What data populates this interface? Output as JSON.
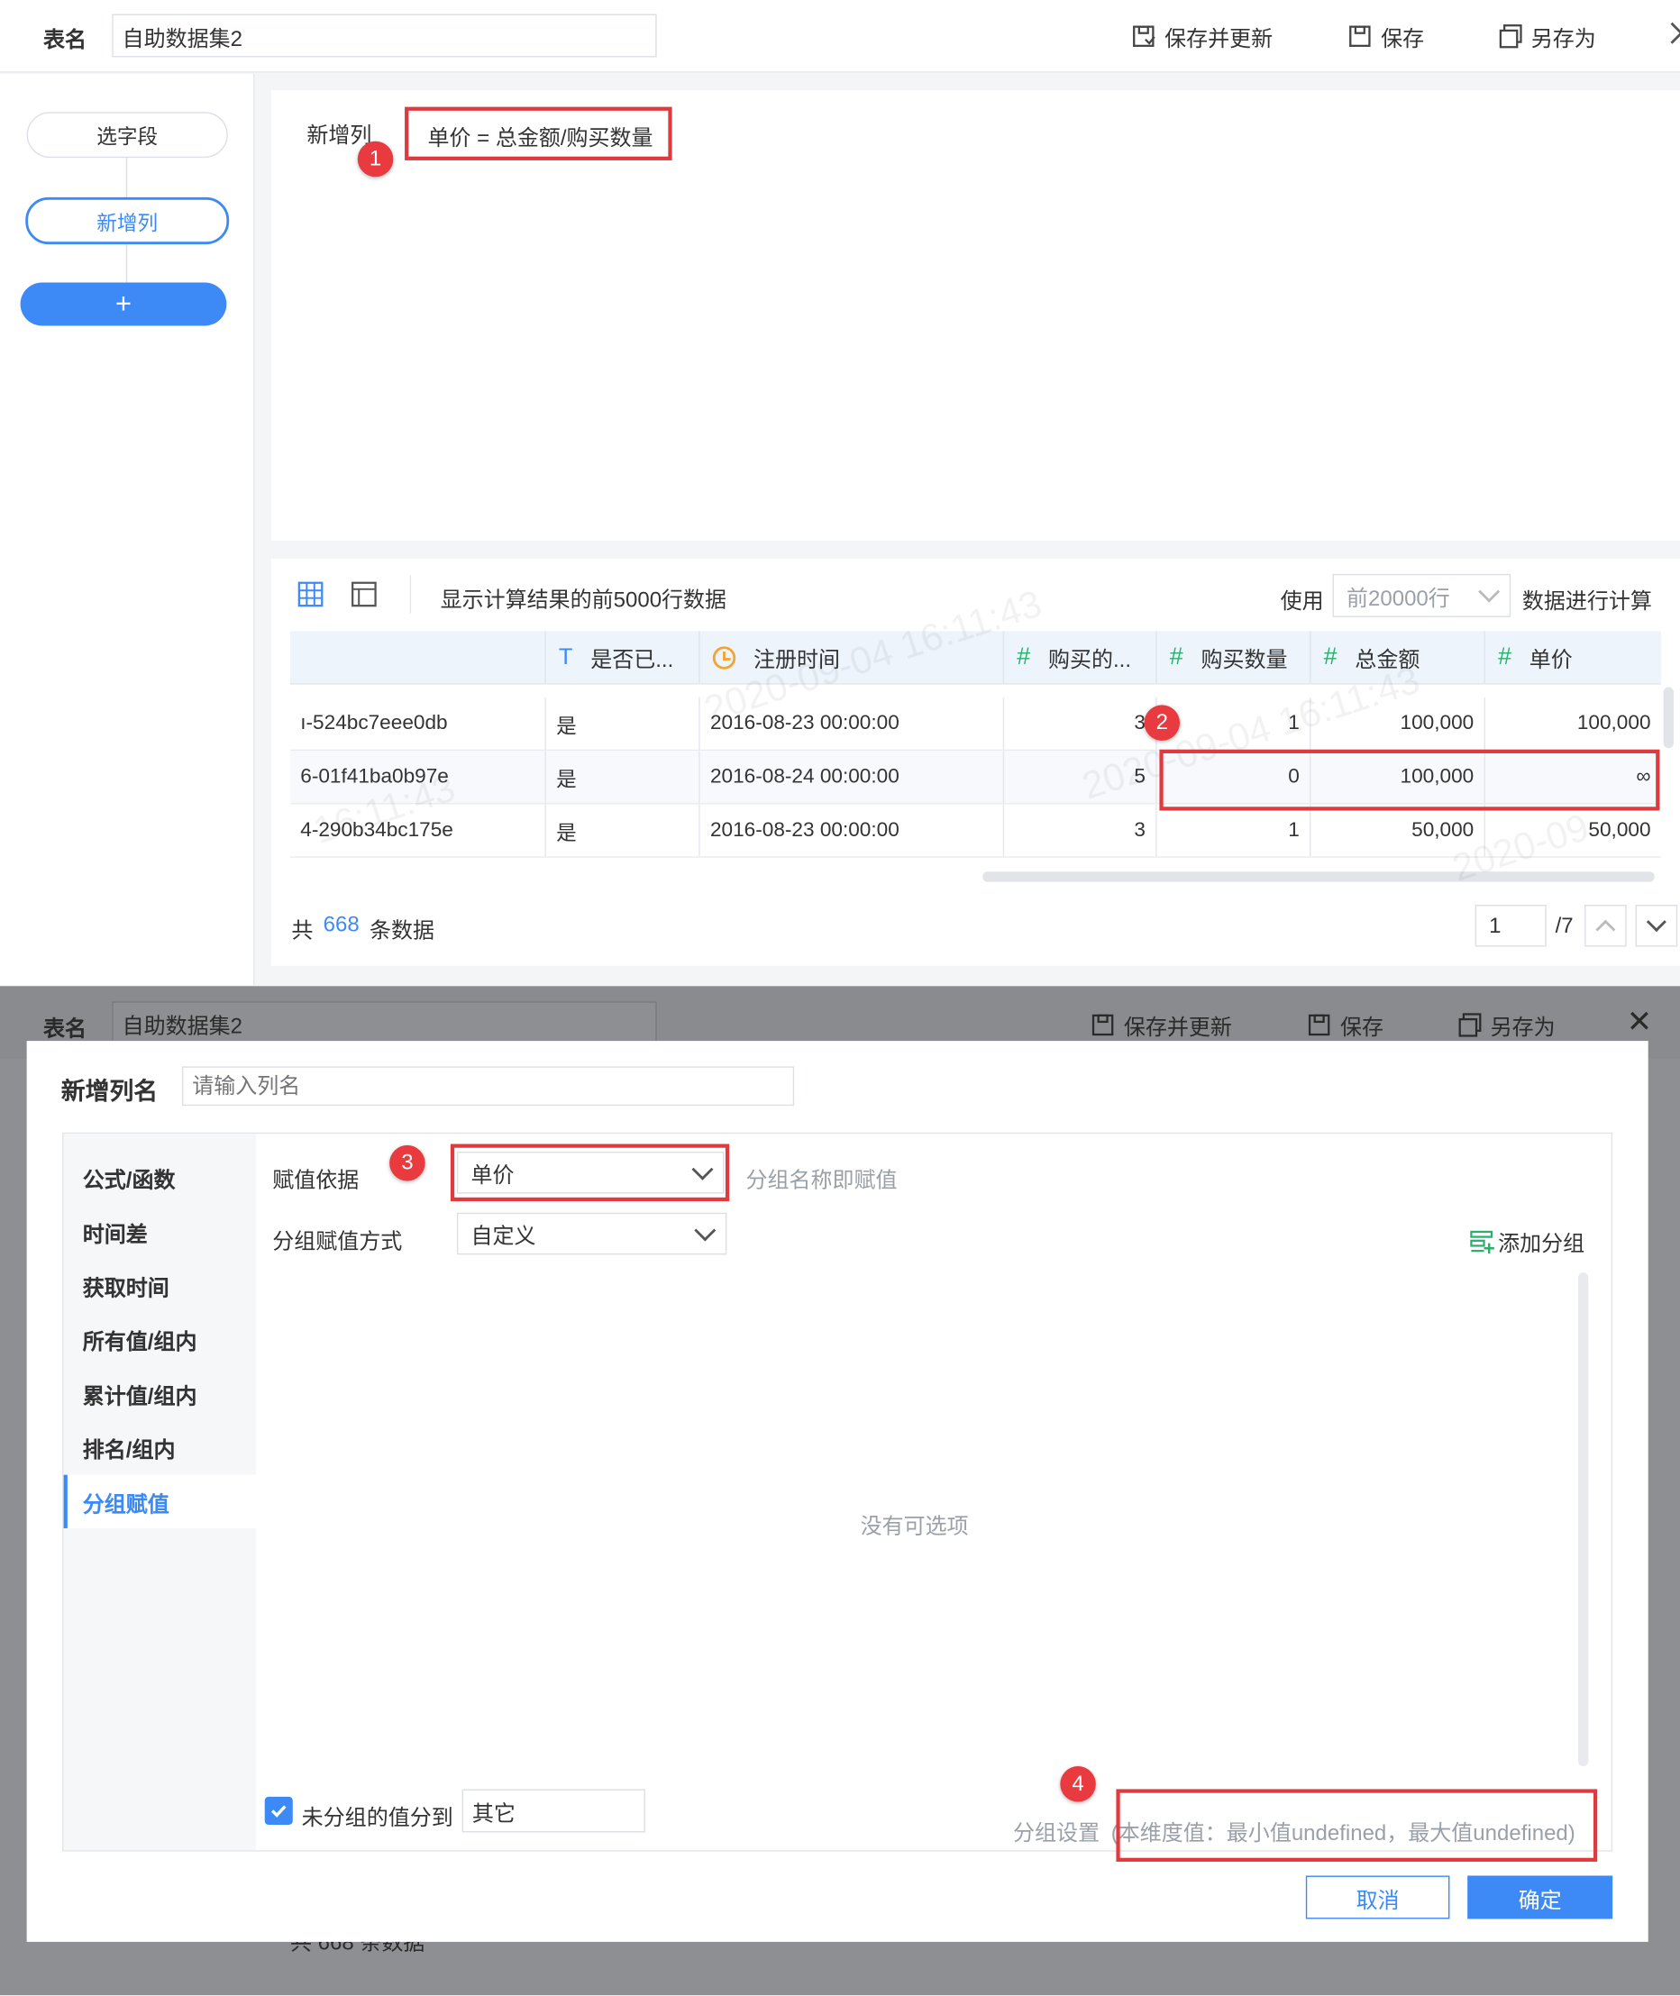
{
  "topbar": {
    "table_name_label": "表名",
    "table_name_value": "自助数据集2",
    "save_update": "保存并更新",
    "save": "保存",
    "save_as": "另存为"
  },
  "steps": {
    "select_fields": "选字段",
    "add_column": "新增列",
    "add_symbol": "+"
  },
  "formula": {
    "label": "新增列",
    "expression": "单价 = 总金额/购买数量"
  },
  "preview": {
    "caption": "显示计算结果的前5000行数据",
    "use_label": "使用",
    "rows_select": "前20000行",
    "compute_label": "数据进行计算",
    "columns": [
      {
        "icon": "",
        "name": ""
      },
      {
        "icon": "T",
        "name": "是否已..."
      },
      {
        "icon": "clock",
        "name": "注册时间"
      },
      {
        "icon": "#",
        "name": "购买的..."
      },
      {
        "icon": "#",
        "name": "购买数量"
      },
      {
        "icon": "#",
        "name": "总金额"
      },
      {
        "icon": "#",
        "name": "单价"
      }
    ],
    "rows": [
      [
        "ı-524bc7eee0db",
        "是",
        "2016-08-23 00:00:00",
        "3",
        "1",
        "100,000",
        "100,000"
      ],
      [
        "6-01f41ba0b97e",
        "是",
        "2016-08-24 00:00:00",
        "5",
        "0",
        "100,000",
        "∞"
      ],
      [
        "4-290b34bc175e",
        "是",
        "2016-08-23 00:00:00",
        "3",
        "1",
        "50,000",
        "50,000"
      ]
    ],
    "total_prefix": "共",
    "total_count": "668",
    "total_suffix": "条数据",
    "page_current": "1",
    "page_total": "/7"
  },
  "watermarks": [
    "2020-09-04 16:11:43",
    "2020-09-04 16:11:43",
    "16:11:43",
    "2020-09"
  ],
  "badges": [
    "1",
    "2",
    "3",
    "4"
  ],
  "modal": {
    "name_label": "新增列名",
    "name_placeholder": "请输入列名",
    "nav": [
      "公式/函数",
      "时间差",
      "获取时间",
      "所有值/组内",
      "累计值/组内",
      "排名/组内",
      "分组赋值"
    ],
    "active_nav": 6,
    "basis_label": "赋值依据",
    "basis_value": "单价",
    "basis_hint": "分组名称即赋值",
    "method_label": "分组赋值方式",
    "method_value": "自定义",
    "add_group": "添加分组",
    "empty_text": "没有可选项",
    "ungrouped_label": "未分组的值分到",
    "ungrouped_value": "其它",
    "group_setting_label": "分组设置",
    "dimension_info": "(本维度值：最小值undefined，最大值undefined)",
    "cancel": "取消",
    "ok": "确定"
  },
  "background_footer": "共 668 条数据",
  "colors": {
    "accent": "#3d8af7",
    "highlight_red": "#e0393e",
    "number_icon_green": "#27b26b",
    "date_icon_orange": "#f4a52f"
  }
}
